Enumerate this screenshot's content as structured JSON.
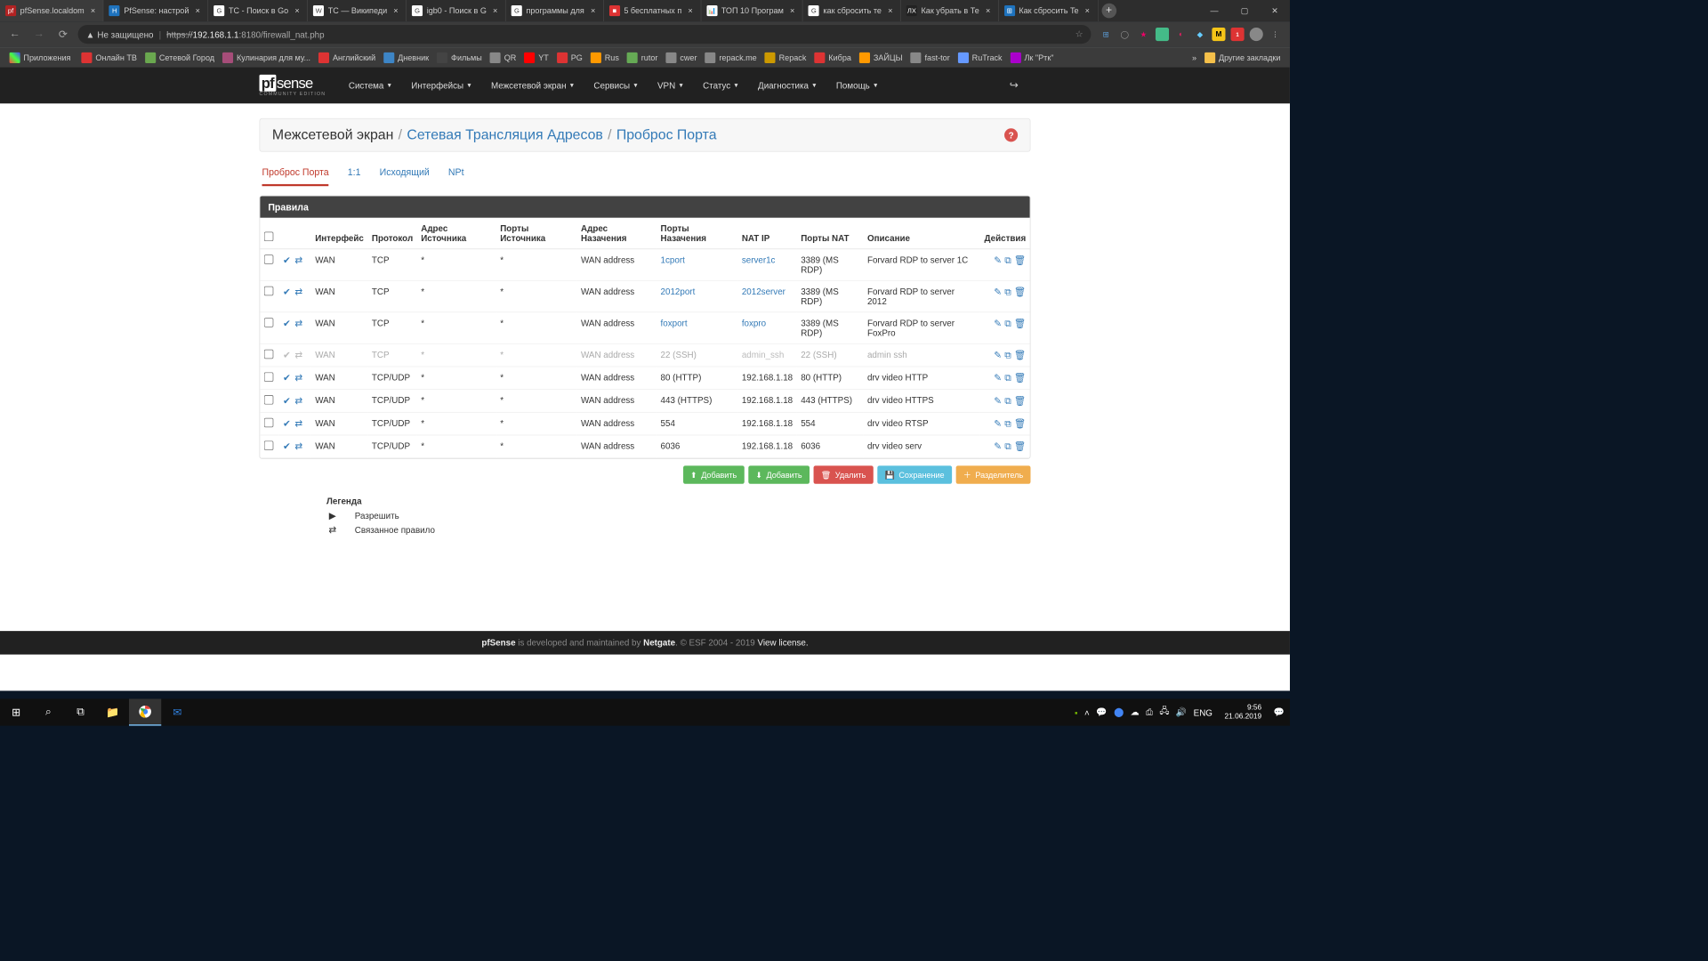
{
  "browser": {
    "tabs": [
      {
        "label": "pfSense.localdom",
        "fav_bg": "#b22222",
        "fav_txt": "pf",
        "active": true
      },
      {
        "label": "PfSense: настрой",
        "fav_bg": "#1e73be",
        "fav_txt": "H",
        "active": false
      },
      {
        "label": "ТС - Поиск в Go",
        "fav_bg": "#fff",
        "fav_txt": "G",
        "active": false
      },
      {
        "label": "ТС — Википеди",
        "fav_bg": "#fff",
        "fav_txt": "W",
        "active": false
      },
      {
        "label": "igb0 - Поиск в G",
        "fav_bg": "#fff",
        "fav_txt": "G",
        "active": false
      },
      {
        "label": "программы для",
        "fav_bg": "#fff",
        "fav_txt": "G",
        "active": false
      },
      {
        "label": "5 бесплатных п",
        "fav_bg": "#d33",
        "fav_txt": "■",
        "active": false
      },
      {
        "label": "ТОП 10 Програм",
        "fav_bg": "#fff",
        "fav_txt": "📊",
        "active": false
      },
      {
        "label": "как сбросить те",
        "fav_bg": "#fff",
        "fav_txt": "G",
        "active": false
      },
      {
        "label": "Как убрать в Те",
        "fav_bg": "#222",
        "fav_txt": "ЛХ",
        "active": false
      },
      {
        "label": "Как сбросить Te",
        "fav_bg": "#1e73be",
        "fav_txt": "⊞",
        "active": false
      }
    ],
    "insecure": "Не защищено",
    "url_prefix": "https://",
    "url_host": "192.168.1.1",
    "url_rest": ":8180/firewall_nat.php",
    "bookmarks_label": "Приложения",
    "bookmarks": [
      {
        "t": "Онлайн ТВ",
        "c": "#d33"
      },
      {
        "t": "Сетевой Город",
        "c": "#6aa84f"
      },
      {
        "t": "Кулинария для му...",
        "c": "#a64d79"
      },
      {
        "t": "Английский",
        "c": "#d33"
      },
      {
        "t": "Дневник",
        "c": "#3d85c6"
      },
      {
        "t": "Фильмы",
        "c": "#444"
      },
      {
        "t": "QR",
        "c": "#888"
      },
      {
        "t": "YT",
        "c": "#f00"
      },
      {
        "t": "PG",
        "c": "#d33"
      },
      {
        "t": "Rus",
        "c": "#f90"
      },
      {
        "t": "rutor",
        "c": "#6a5"
      },
      {
        "t": "cwer",
        "c": "#888"
      },
      {
        "t": "repack.me",
        "c": "#888"
      },
      {
        "t": "Repack",
        "c": "#c90"
      },
      {
        "t": "Кибра",
        "c": "#d33"
      },
      {
        "t": "ЗАЙЦЫ",
        "c": "#f90"
      },
      {
        "t": "fast-tor",
        "c": "#888"
      },
      {
        "t": "RuTrack",
        "c": "#69f"
      },
      {
        "t": "Лк \"Ртк\"",
        "c": "#a0c"
      }
    ],
    "other_bookmarks": "Другие закладки"
  },
  "nav": {
    "items": [
      "Система",
      "Интерфейсы",
      "Межсетевой экран",
      "Сервисы",
      "VPN",
      "Статус",
      "Диагностика",
      "Помощь"
    ]
  },
  "breadcrumb": {
    "a": "Межсетевой экран",
    "b": "Сетевая Трансляция Адресов",
    "c": "Проброс Порта"
  },
  "subtabs": [
    "Проброс Порта",
    "1:1",
    "Исходящий",
    "NPt"
  ],
  "panel_title": "Правила",
  "th": {
    "iface": "Интерфейс",
    "proto": "Протокол",
    "sa": "Адрес Источника",
    "sp": "Порты Источника",
    "da": "Адрес Назачения",
    "dp": "Порты Назачения",
    "nip": "NAT IP",
    "np": "Порты NAT",
    "desc": "Описание",
    "act": "Действия"
  },
  "rows": [
    {
      "dis": false,
      "iface": "WAN",
      "proto": "TCP",
      "sa": "*",
      "sp": "*",
      "da": "WAN address",
      "dp": "1cport",
      "dp_link": true,
      "nip": "server1c",
      "nip_link": true,
      "np": "3389 (MS RDP)",
      "desc": "Forvard RDP to server 1C"
    },
    {
      "dis": false,
      "iface": "WAN",
      "proto": "TCP",
      "sa": "*",
      "sp": "*",
      "da": "WAN address",
      "dp": "2012port",
      "dp_link": true,
      "nip": "2012server",
      "nip_link": true,
      "np": "3389 (MS RDP)",
      "desc": "Forvard RDP to server 2012"
    },
    {
      "dis": false,
      "iface": "WAN",
      "proto": "TCP",
      "sa": "*",
      "sp": "*",
      "da": "WAN address",
      "dp": "foxport",
      "dp_link": true,
      "nip": "foxpro",
      "nip_link": true,
      "np": "3389 (MS RDP)",
      "desc": "Forvard RDP to server FoxPro"
    },
    {
      "dis": true,
      "iface": "WAN",
      "proto": "TCP",
      "sa": "*",
      "sp": "*",
      "da": "WAN address",
      "dp": "22 (SSH)",
      "dp_link": false,
      "nip": "admin_ssh",
      "nip_link": true,
      "np": "22 (SSH)",
      "desc": "admin ssh"
    },
    {
      "dis": false,
      "iface": "WAN",
      "proto": "TCP/UDP",
      "sa": "*",
      "sp": "*",
      "da": "WAN address",
      "dp": "80 (HTTP)",
      "dp_link": false,
      "nip": "192.168.1.18",
      "nip_link": false,
      "np": "80 (HTTP)",
      "desc": "drv video HTTP"
    },
    {
      "dis": false,
      "iface": "WAN",
      "proto": "TCP/UDP",
      "sa": "*",
      "sp": "*",
      "da": "WAN address",
      "dp": "443 (HTTPS)",
      "dp_link": false,
      "nip": "192.168.1.18",
      "nip_link": false,
      "np": "443 (HTTPS)",
      "desc": "drv video HTTPS"
    },
    {
      "dis": false,
      "iface": "WAN",
      "proto": "TCP/UDP",
      "sa": "*",
      "sp": "*",
      "da": "WAN address",
      "dp": "554",
      "dp_link": false,
      "nip": "192.168.1.18",
      "nip_link": false,
      "np": "554",
      "desc": "drv video RTSP"
    },
    {
      "dis": false,
      "iface": "WAN",
      "proto": "TCP/UDP",
      "sa": "*",
      "sp": "*",
      "da": "WAN address",
      "dp": "6036",
      "dp_link": false,
      "nip": "192.168.1.18",
      "nip_link": false,
      "np": "6036",
      "desc": "drv video serv"
    }
  ],
  "buttons": {
    "add1": "Добавить",
    "add2": "Добавить",
    "del": "Удалить",
    "save": "Сохранение",
    "sep": "Разделитель"
  },
  "legend": {
    "title": "Легенда",
    "allow": "Разрешить",
    "linked": "Связанное правило"
  },
  "footer": {
    "a": "pfSense",
    "b": " is developed and maintained by ",
    "c": "Netgate",
    "d": ". © ESF 2004 - 2019 ",
    "e": "View license."
  },
  "taskbar": {
    "time": "9:56",
    "date": "21.06.2019",
    "lang": "ENG"
  }
}
